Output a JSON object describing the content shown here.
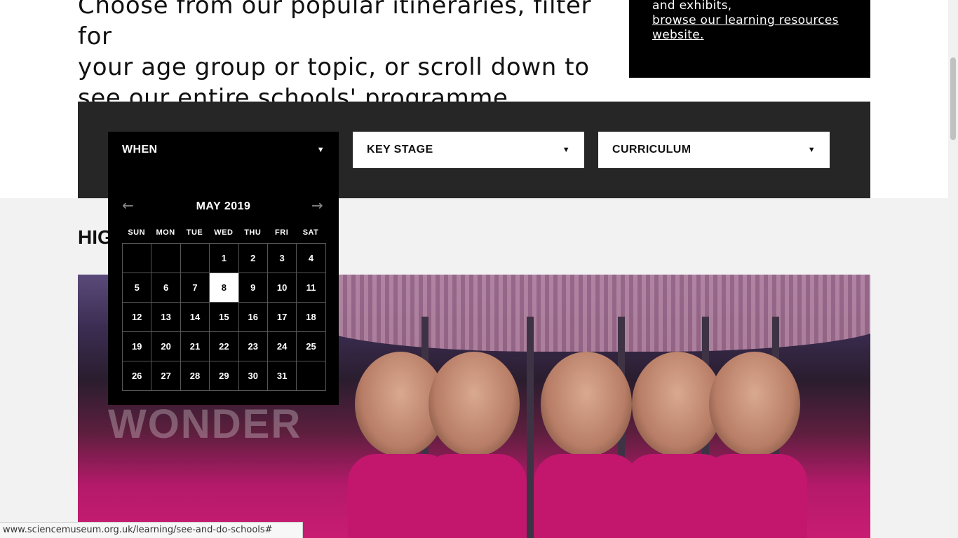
{
  "intro": {
    "line1": "Choose from our popular itineraries, filter for",
    "line2": "your age group or topic, or scroll down to",
    "line3": "see our entire schools' programme."
  },
  "side_box": {
    "text": "and exhibits,",
    "link_line1": "browse our learning resources",
    "link_line2": "website."
  },
  "filters": {
    "when_label": "WHEN",
    "key_stage_label": "KEY STAGE",
    "curriculum_label": "CURRICULUM",
    "caret": "▼"
  },
  "calendar": {
    "month_label": "MAY 2019",
    "prev_arrow": "←",
    "next_arrow": "→",
    "weekdays": [
      "SUN",
      "MON",
      "TUE",
      "WED",
      "THU",
      "FRI",
      "SAT"
    ],
    "leading_blanks": 3,
    "days_in_month": 31,
    "selected_day": 8
  },
  "section": {
    "heading": "HIG"
  },
  "hero": {
    "overlay_word": "WONDER"
  },
  "status_bar": {
    "url": "www.sciencemuseum.org.uk/learning/see-and-do-schools#"
  },
  "colors": {
    "dark_panel": "#262626",
    "calendar_bg": "#000000",
    "hero_pink": "#c2176d"
  }
}
